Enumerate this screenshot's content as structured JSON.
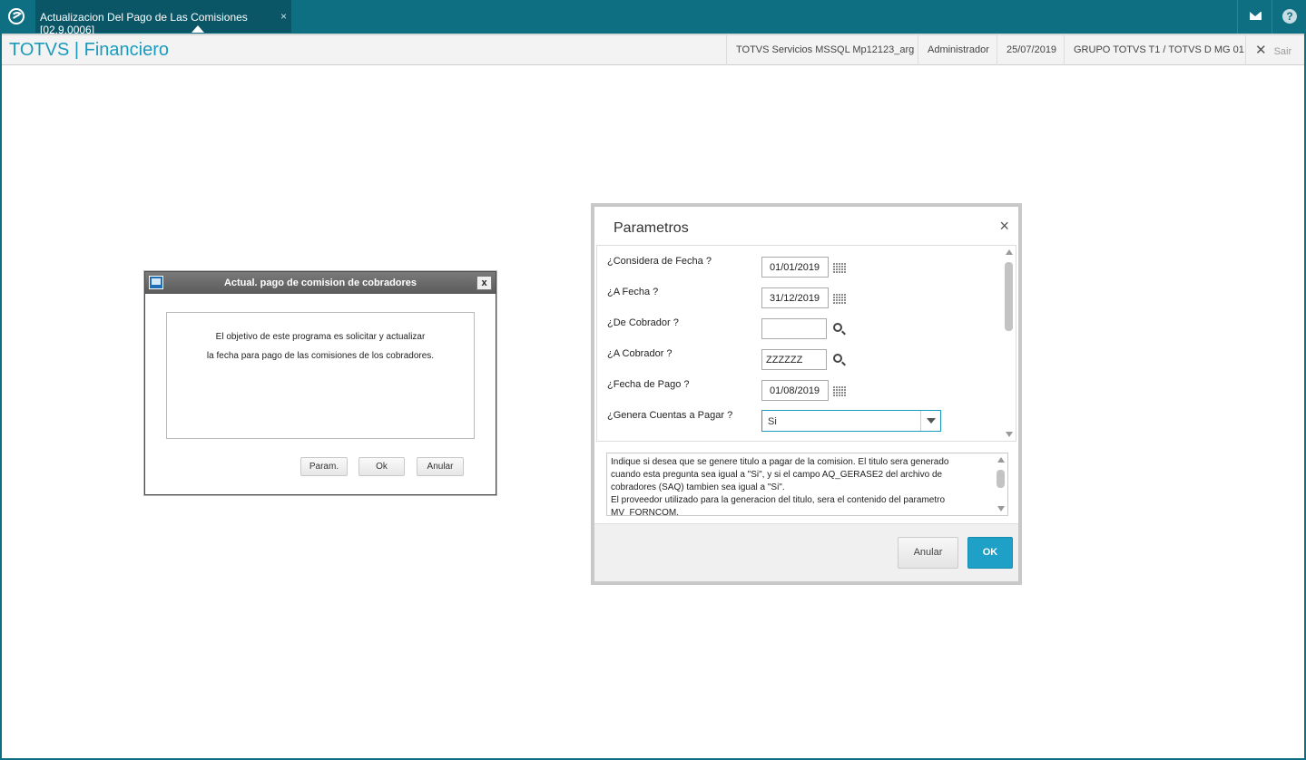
{
  "window": {
    "tab_title": "Actualizacion Del Pago de Las Comisiones [02.9.0006]",
    "tab_close": "×"
  },
  "header": {
    "brand": "TOTVS | Financiero",
    "server": "TOTVS Servicios MSSQL Mp12123_arg",
    "user": "Administrador",
    "date": "25/07/2019",
    "company": "GRUPO TOTVS T1 / TOTVS D MG 01",
    "logout_label": "Sair"
  },
  "small_dialog": {
    "title": "Actual. pago de comision de cobradores",
    "close": "x",
    "message_line1": "El objetivo de este programa es solicitar y actualizar",
    "message_line2": "la fecha para pago de las comisiones de los cobradores.",
    "buttons": {
      "param": "Param.",
      "ok": "Ok",
      "cancel": "Anular"
    }
  },
  "param_dialog": {
    "title": "Parametros",
    "close": "×",
    "fields": [
      {
        "label": "¿Considera de Fecha ?",
        "value": "01/01/2019",
        "type": "date"
      },
      {
        "label": "¿A Fecha ?",
        "value": "31/12/2019",
        "type": "date"
      },
      {
        "label": "¿De Cobrador ?",
        "value": "",
        "type": "lookup"
      },
      {
        "label": "¿A Cobrador ?",
        "value": "ZZZZZZ",
        "type": "lookup"
      },
      {
        "label": "¿Fecha de Pago ?",
        "value": "01/08/2019",
        "type": "date"
      },
      {
        "label": "¿Genera Cuentas a Pagar ?",
        "value": "Si",
        "type": "select"
      }
    ],
    "help_lines": [
      "Indique si desea que se genere titulo a pagar de la comision. El titulo sera generado",
      "cuando esta pregunta sea igual a \"Si\", y si el campo AQ_GERASE2 del archivo de",
      "cobradores (SAQ) tambien sea igual a \"Si\".",
      "El proveedor utilizado para la generacion del titulo, sera el contenido del parametro",
      "MV_FORNCOM."
    ],
    "buttons": {
      "cancel": "Anular",
      "ok": "OK"
    }
  }
}
